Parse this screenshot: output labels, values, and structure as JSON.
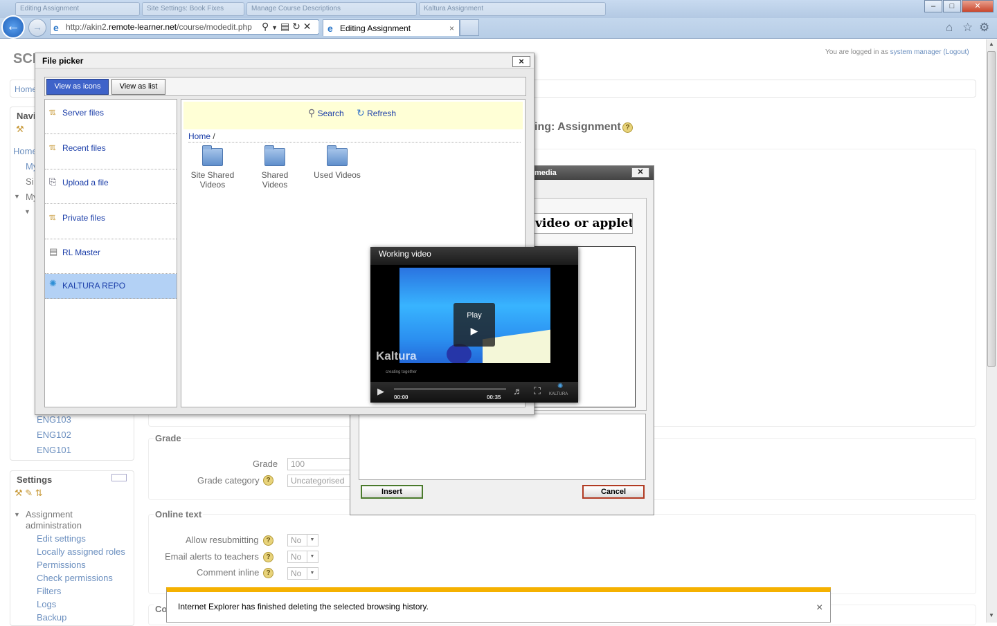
{
  "browser": {
    "tabs_background": [
      "Editing Assignment",
      "Site Settings: Book Fixes",
      "Manage Course Descriptions",
      "Kaltura Assignment"
    ],
    "url_domain_prefix": "http://akin2.",
    "url_domain": "remote-learner.net",
    "url_path": "/course/modedit.php",
    "active_tab_title": "Editing Assignment",
    "minimize": "–",
    "maximize": "□",
    "close": "✕"
  },
  "page": {
    "logo_text": "SCI",
    "login_text": "You are logged in as",
    "login_user": "system manager",
    "logout": "(Logout)",
    "breadcrumb_home": "Home",
    "heading_partial": "ing: Assignment",
    "nav_block_title": "Navi",
    "nav_items": [
      "Home",
      "My",
      "Si",
      "My"
    ],
    "courses": [
      "ENG103",
      "ENG102",
      "ENG101"
    ],
    "settings_title": "Settings",
    "settings_section": "Assignment administration",
    "settings_links": [
      "Edit settings",
      "Locally assigned roles",
      "Permissions",
      "Check permissions",
      "Filters",
      "Logs",
      "Backup"
    ],
    "grade_legend": "Grade",
    "grade_label": "Grade",
    "grade_value": "100",
    "grade_category_label": "Grade category",
    "grade_category_value": "Uncategorised",
    "online_text_legend": "Online text",
    "allow_resubmitting_label": "Allow resubmitting",
    "allow_resubmitting_value": "No",
    "email_alerts_label": "Email alerts to teachers",
    "email_alerts_value": "No",
    "comment_inline_label": "Comment inline",
    "comment_inline_value": "No",
    "partial_legend": "Co"
  },
  "file_picker": {
    "title": "File picker",
    "view_as_icons": "View as icons",
    "view_as_list": "View as list",
    "repositories": [
      "Server files",
      "Recent files",
      "Upload a file",
      "Private files",
      "RL Master",
      "KALTURA REPO"
    ],
    "active_repository": "KALTURA REPO",
    "search": "Search",
    "refresh": "Refresh",
    "breadcrumb_home": "Home",
    "breadcrumb_sep": "/",
    "folders": [
      "Site Shared Videos",
      "Shared Videos",
      "Used Videos"
    ]
  },
  "media_dialog": {
    "title": "media",
    "heading": "video or applet...",
    "insert": "Insert",
    "cancel": "Cancel"
  },
  "video": {
    "title": "Working video",
    "play_label": "Play",
    "time_current": "00:00",
    "time_total": "00:35",
    "brand": "Kaltura",
    "brand_tagline": "creating together",
    "brand_small": "KALTURA"
  },
  "notification": {
    "text": "Internet Explorer has finished deleting the selected browsing history.",
    "close": "×"
  },
  "colors": {
    "link": "#6b8fbf",
    "fp_active_button": "#3f63c9",
    "fp_active_repo": "#b3d1f5",
    "notification_bar": "#f5b100",
    "insert_border": "#4a7a2c",
    "cancel_border": "#b13a22"
  },
  "icons": [
    "back-icon",
    "forward-icon",
    "ie-icon",
    "search-icon",
    "refresh-icon",
    "stop-icon",
    "home-icon",
    "favorites-icon",
    "tools-icon",
    "folder-icon",
    "play-icon",
    "volume-icon",
    "fullscreen-icon",
    "help-icon",
    "close-icon"
  ]
}
